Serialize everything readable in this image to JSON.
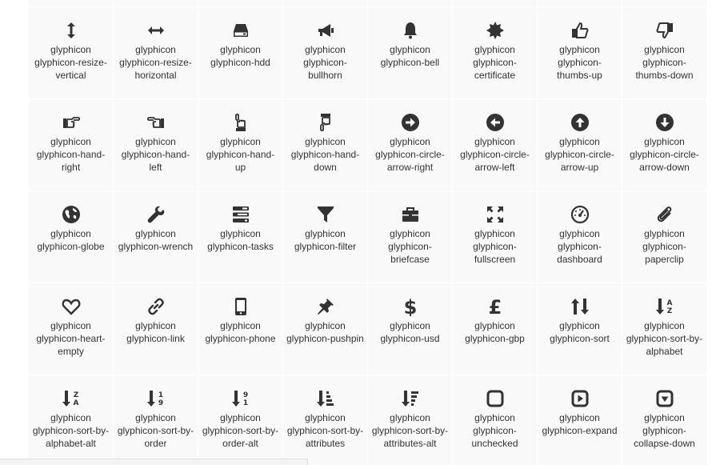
{
  "icon_grid": {
    "rows": [
      [
        {
          "icon": "partial-icon",
          "line1": "",
          "line2": ""
        },
        {
          "icon": "partial-icon",
          "line1": "",
          "line2": ""
        },
        {
          "icon": "partial-icon",
          "line1": "",
          "line2": ""
        },
        {
          "icon": "partial-icon",
          "line1": "",
          "line2": ""
        },
        {
          "icon": "partial-icon",
          "line1": "",
          "line2": ""
        },
        {
          "icon": "partial-icon",
          "line1": "",
          "line2": ""
        },
        {
          "icon": "partial-icon",
          "line1": "",
          "line2": ""
        },
        {
          "icon": "partial-icon",
          "line1": "",
          "line2": ""
        }
      ],
      [
        {
          "icon": "resize-vertical-icon",
          "line1": "glyphicon",
          "line2": "glyphicon-resize-vertical"
        },
        {
          "icon": "resize-horizontal-icon",
          "line1": "glyphicon",
          "line2": "glyphicon-resize-horizontal"
        },
        {
          "icon": "hdd-icon",
          "line1": "glyphicon",
          "line2": "glyphicon-hdd"
        },
        {
          "icon": "bullhorn-icon",
          "line1": "glyphicon",
          "line2": "glyphicon-bullhorn"
        },
        {
          "icon": "bell-icon",
          "line1": "glyphicon",
          "line2": "glyphicon-bell"
        },
        {
          "icon": "certificate-icon",
          "line1": "glyphicon",
          "line2": "glyphicon-certificate"
        },
        {
          "icon": "thumbs-up-icon",
          "line1": "glyphicon",
          "line2": "glyphicon-thumbs-up"
        },
        {
          "icon": "thumbs-down-icon",
          "line1": "glyphicon",
          "line2": "glyphicon-thumbs-down"
        }
      ],
      [
        {
          "icon": "hand-right-icon",
          "line1": "glyphicon",
          "line2": "glyphicon-hand-right"
        },
        {
          "icon": "hand-left-icon",
          "line1": "glyphicon",
          "line2": "glyphicon-hand-left"
        },
        {
          "icon": "hand-up-icon",
          "line1": "glyphicon",
          "line2": "glyphicon-hand-up"
        },
        {
          "icon": "hand-down-icon",
          "line1": "glyphicon",
          "line2": "glyphicon-hand-down"
        },
        {
          "icon": "circle-arrow-right-icon",
          "line1": "glyphicon",
          "line2": "glyphicon-circle-arrow-right"
        },
        {
          "icon": "circle-arrow-left-icon",
          "line1": "glyphicon",
          "line2": "glyphicon-circle-arrow-left"
        },
        {
          "icon": "circle-arrow-up-icon",
          "line1": "glyphicon",
          "line2": "glyphicon-circle-arrow-up"
        },
        {
          "icon": "circle-arrow-down-icon",
          "line1": "glyphicon",
          "line2": "glyphicon-circle-arrow-down"
        }
      ],
      [
        {
          "icon": "globe-icon",
          "line1": "glyphicon",
          "line2": "glyphicon-globe"
        },
        {
          "icon": "wrench-icon",
          "line1": "glyphicon",
          "line2": "glyphicon-wrench"
        },
        {
          "icon": "tasks-icon",
          "line1": "glyphicon",
          "line2": "glyphicon-tasks"
        },
        {
          "icon": "filter-icon",
          "line1": "glyphicon",
          "line2": "glyphicon-filter"
        },
        {
          "icon": "briefcase-icon",
          "line1": "glyphicon",
          "line2": "glyphicon-briefcase"
        },
        {
          "icon": "fullscreen-icon",
          "line1": "glyphicon",
          "line2": "glyphicon-fullscreen"
        },
        {
          "icon": "dashboard-icon",
          "line1": "glyphicon",
          "line2": "glyphicon-dashboard"
        },
        {
          "icon": "paperclip-icon",
          "line1": "glyphicon",
          "line2": "glyphicon-paperclip"
        }
      ],
      [
        {
          "icon": "heart-empty-icon",
          "line1": "glyphicon",
          "line2": "glyphicon-heart-empty"
        },
        {
          "icon": "link-icon",
          "line1": "glyphicon",
          "line2": "glyphicon-link"
        },
        {
          "icon": "phone-icon",
          "line1": "glyphicon",
          "line2": "glyphicon-phone"
        },
        {
          "icon": "pushpin-icon",
          "line1": "glyphicon",
          "line2": "glyphicon-pushpin"
        },
        {
          "icon": "usd-icon",
          "line1": "glyphicon",
          "line2": "glyphicon-usd"
        },
        {
          "icon": "gbp-icon",
          "line1": "glyphicon",
          "line2": "glyphicon-gbp"
        },
        {
          "icon": "sort-icon",
          "line1": "glyphicon",
          "line2": "glyphicon-sort"
        },
        {
          "icon": "sort-by-alphabet-icon",
          "line1": "glyphicon",
          "line2": "glyphicon-sort-by-alphabet"
        }
      ],
      [
        {
          "icon": "sort-by-alphabet-alt-icon",
          "line1": "glyphicon",
          "line2": "glyphicon-sort-by-alphabet-alt"
        },
        {
          "icon": "sort-by-order-icon",
          "line1": "glyphicon",
          "line2": "glyphicon-sort-by-order"
        },
        {
          "icon": "sort-by-order-alt-icon",
          "line1": "glyphicon",
          "line2": "glyphicon-sort-by-order-alt"
        },
        {
          "icon": "sort-by-attributes-icon",
          "line1": "glyphicon",
          "line2": "glyphicon-sort-by-attributes"
        },
        {
          "icon": "sort-by-attributes-alt-icon",
          "line1": "glyphicon",
          "line2": "glyphicon-sort-by-attributes-alt"
        },
        {
          "icon": "unchecked-icon",
          "line1": "glyphicon",
          "line2": "glyphicon-unchecked"
        },
        {
          "icon": "expand-icon",
          "line1": "glyphicon",
          "line2": "glyphicon-expand"
        },
        {
          "icon": "collapse-down-icon",
          "line1": "glyphicon",
          "line2": "glyphicon-collapse-down"
        }
      ]
    ]
  },
  "colors": {
    "cell_background": "#f9f9f9",
    "cell_text": "#333333",
    "icon": "#333333"
  }
}
